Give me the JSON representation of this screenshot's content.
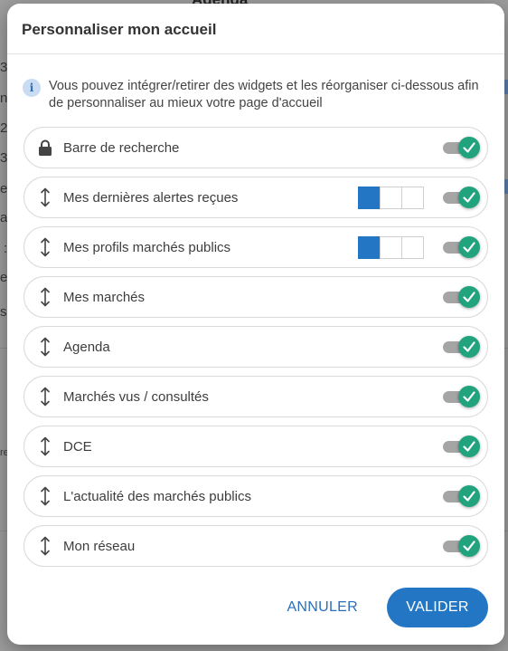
{
  "backdrop": {
    "heading": "Agenda",
    "fragments": [
      "3",
      "n",
      "2",
      "3",
      "e",
      "s",
      "at",
      ":",
      "e",
      "s",
      "re"
    ]
  },
  "dialog": {
    "title": "Personnaliser mon accueil",
    "info_text": "Vous pouvez intégrer/retirer des widgets et les réorganiser ci-dessous afin de personnaliser au mieux votre page d'accueil",
    "widgets": [
      {
        "label": "Barre de recherche",
        "icon": "lock-icon",
        "enabled": true,
        "size": null
      },
      {
        "label": "Mes dernières alertes reçues",
        "icon": "drag-handle-icon",
        "enabled": true,
        "size": 1
      },
      {
        "label": "Mes profils marchés publics",
        "icon": "drag-handle-icon",
        "enabled": true,
        "size": 1
      },
      {
        "label": "Mes marchés",
        "icon": "drag-handle-icon",
        "enabled": true,
        "size": null
      },
      {
        "label": "Agenda",
        "icon": "drag-handle-icon",
        "enabled": true,
        "size": null
      },
      {
        "label": "Marchés vus / consultés",
        "icon": "drag-handle-icon",
        "enabled": true,
        "size": null
      },
      {
        "label": "DCE",
        "icon": "drag-handle-icon",
        "enabled": true,
        "size": null
      },
      {
        "label": "L'actualité des marchés publics",
        "icon": "drag-handle-icon",
        "enabled": true,
        "size": null
      },
      {
        "label": "Mon réseau",
        "icon": "drag-handle-icon",
        "enabled": true,
        "size": null
      }
    ],
    "cancel_label": "ANNULER",
    "validate_label": "VALIDER"
  },
  "colors": {
    "accent": "#2276c3",
    "toggle_on": "#21a37e",
    "info_bg": "#c9dcf3"
  }
}
